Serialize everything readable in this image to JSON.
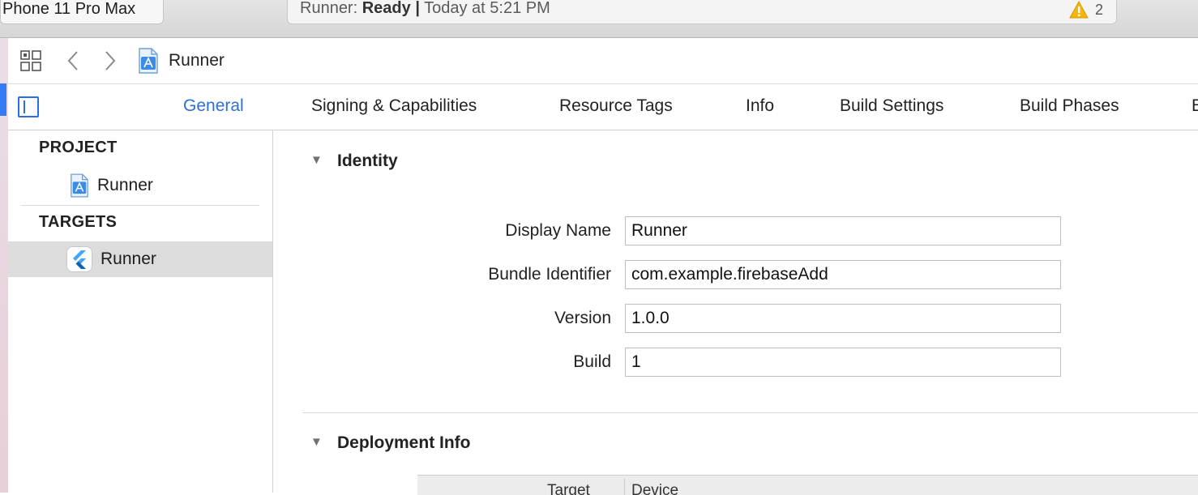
{
  "toolbar": {
    "scheme_device": "Phone 11 Pro Max",
    "activity": {
      "app": "Runner:",
      "state": "Ready",
      "separator": "|",
      "time": "Today at 5:21 PM"
    },
    "warning_count": "2",
    "warning_color": "#f5b50a"
  },
  "jumpbar": {
    "icons": [
      "related-items-grid-icon",
      "back-chevron-icon",
      "forward-chevron-icon",
      "xcode-project-icon"
    ],
    "title": "Runner"
  },
  "tabs": [
    {
      "label": "General",
      "active": true
    },
    {
      "label": "Signing & Capabilities",
      "active": false
    },
    {
      "label": "Resource Tags",
      "active": false
    },
    {
      "label": "Info",
      "active": false
    },
    {
      "label": "Build Settings",
      "active": false
    },
    {
      "label": "Build Phases",
      "active": false
    },
    {
      "label": "B",
      "active": false
    }
  ],
  "accent_color": "#2e6fd8",
  "sidebar": {
    "project_header": "PROJECT",
    "project_item": "Runner",
    "targets_header": "TARGETS",
    "target_item": "Runner"
  },
  "identity": {
    "title": "Identity",
    "fields": {
      "display_name": {
        "label": "Display Name",
        "value": "Runner"
      },
      "bundle_identifier": {
        "label": "Bundle Identifier",
        "value": "com.example.firebaseAdd"
      },
      "version": {
        "label": "Version",
        "value": "1.0.0"
      },
      "build": {
        "label": "Build",
        "value": "1"
      }
    }
  },
  "deployment": {
    "title": "Deployment Info",
    "columns": [
      "Target",
      "Device"
    ]
  }
}
